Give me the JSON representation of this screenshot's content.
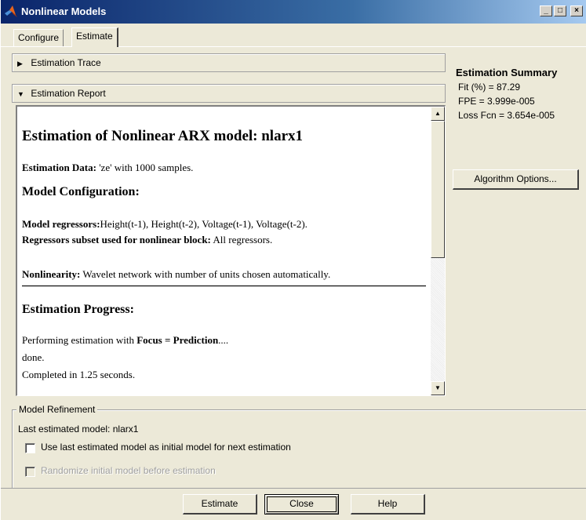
{
  "window": {
    "title": "Nonlinear Models",
    "controls": {
      "minimize": "_",
      "maximize": "□",
      "close": "×"
    }
  },
  "tabs": [
    {
      "label": "Configure",
      "active": false
    },
    {
      "label": "Estimate",
      "active": true
    }
  ],
  "trace_panel": {
    "label": "Estimation Trace",
    "expanded": false
  },
  "report_panel": {
    "label": "Estimation Report",
    "expanded": true,
    "title": "Estimation of Nonlinear ARX model: nlarx1",
    "data_label": "Estimation Data:",
    "data_value": " 'ze' with 1000 samples.",
    "config_heading": "Model Configuration:",
    "regressors_label": "Model regressors:",
    "regressors_value": "Height(t-1), Height(t-2), Voltage(t-1), Voltage(t-2).",
    "subset_label": "Regressors subset used for nonlinear block:",
    "subset_value": " All regressors.",
    "nonlinearity_label": "Nonlinearity:",
    "nonlinearity_value": " Wavelet network with number of units chosen automatically.",
    "progress_heading": "Estimation Progress:",
    "progress_line1_pre": "Performing estimation with ",
    "progress_line1_bold": "Focus = Prediction",
    "progress_line1_post": "....",
    "progress_line2": "done.",
    "progress_line3": "Completed in 1.25 seconds."
  },
  "summary": {
    "title": "Estimation Summary",
    "fit": "Fit (%) = 87.29",
    "fpe": "FPE = 3.999e-005",
    "loss": "Loss Fcn = 3.654e-005",
    "algorithm_button": "Algorithm Options..."
  },
  "refinement": {
    "legend": "Model Refinement",
    "last_model": "Last estimated model: nlarx1",
    "use_last_label": "Use last estimated model as initial model for next estimation",
    "use_last_checked": false,
    "randomize_label": "Randomize initial model before estimation",
    "randomize_checked": false,
    "randomize_enabled": false
  },
  "buttons": {
    "estimate": "Estimate",
    "close": "Close",
    "help": "Help"
  },
  "icons": {
    "title_icon": "matlab-logo-icon",
    "collapsed": "triangle-right-icon",
    "expanded": "triangle-down-icon"
  },
  "colors": {
    "title_start": "#0a246a",
    "title_end": "#a6caf0",
    "face": "#ece9d8"
  }
}
